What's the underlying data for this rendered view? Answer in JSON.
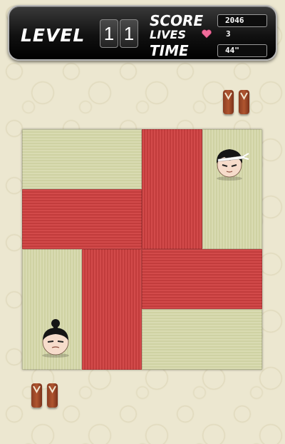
{
  "hud": {
    "level_label": "LEVEL",
    "level_digits": [
      "1",
      "1"
    ],
    "score_label": "SCORE",
    "score_value": "2046",
    "lives_label": "LIVES",
    "lives_value": "3",
    "time_label": "TIME",
    "time_value": "44\""
  },
  "colors": {
    "tatami_green": "#d9dbb2",
    "tatami_red": "#d24a4a",
    "hud_bg": "#111111",
    "background": "#ece7d0"
  },
  "board": {
    "rows": 4,
    "cols": 4
  }
}
